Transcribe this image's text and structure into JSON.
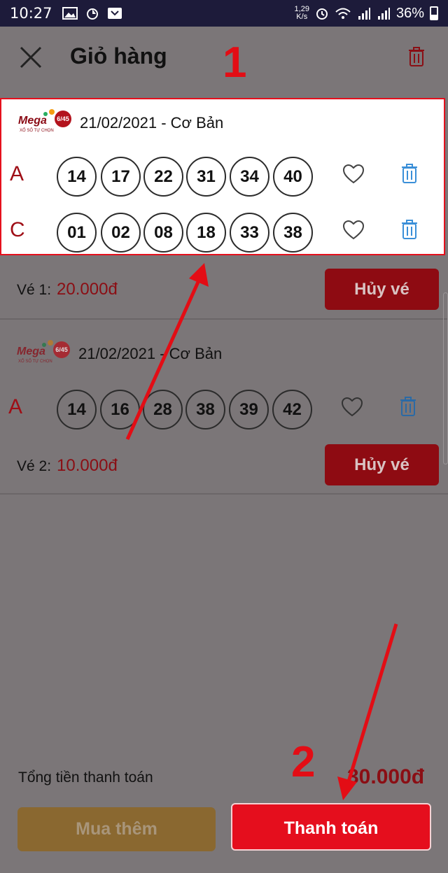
{
  "status_bar": {
    "time": "10:27",
    "net_speed_value": "1,29",
    "net_speed_unit": "K/s",
    "battery": "36%"
  },
  "header": {
    "title": "Giỏ hàng"
  },
  "tickets": [
    {
      "date": "21/02/2021 - Cơ Bản",
      "rows": [
        {
          "letter": "A",
          "numbers": [
            "14",
            "17",
            "22",
            "31",
            "34",
            "40"
          ]
        },
        {
          "letter": "C",
          "numbers": [
            "01",
            "02",
            "08",
            "18",
            "33",
            "38"
          ]
        }
      ],
      "price_label": "Vé 1:",
      "price": "20.000đ",
      "cancel_label": "Hủy vé"
    },
    {
      "date": "21/02/2021 - Cơ Bản",
      "rows": [
        {
          "letter": "A",
          "numbers": [
            "14",
            "16",
            "28",
            "38",
            "39",
            "42"
          ]
        }
      ],
      "price_label": "Vé 2:",
      "price": "10.000đ",
      "cancel_label": "Hủy vé"
    }
  ],
  "logo": {
    "brand": "Mega",
    "badge": "6/45",
    "tagline": "XỔ SỐ TỰ CHỌN"
  },
  "footer": {
    "total_label": "Tổng tiền thanh toán",
    "total_value": "30.000đ",
    "more_label": "Mua thêm",
    "pay_label": "Thanh toán"
  },
  "annotations": {
    "step1": "1",
    "step2": "2"
  },
  "colors": {
    "accent_red": "#e50e1d",
    "dim_red": "#8e0b12",
    "status_bar": "#1d1b3a",
    "overlay": "#7b7678",
    "annotation": "#e30d15"
  }
}
